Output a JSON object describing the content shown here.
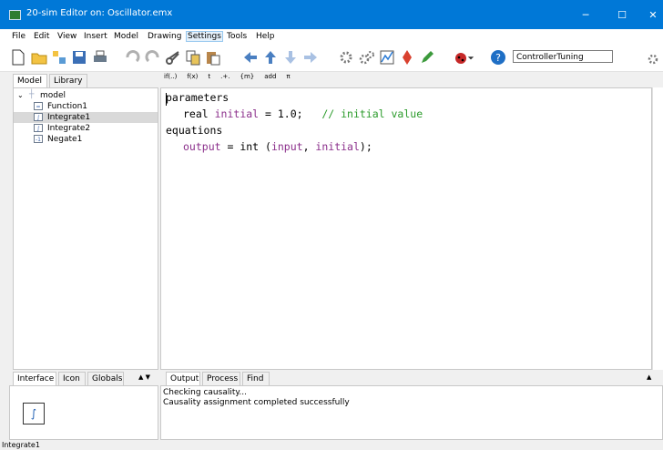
{
  "window": {
    "title": "20-sim Editor on: Oscillator.emx",
    "minimize": "─",
    "maximize": "☐",
    "close": "✕"
  },
  "menu": [
    "File",
    "Edit",
    "View",
    "Insert",
    "Model",
    "Drawing",
    "Settings",
    "Tools",
    "Help"
  ],
  "toolbar": {
    "combo_value": "ControllerTuning"
  },
  "symbols": [
    "if(..)",
    "f(x)",
    "t",
    ".+.",
    "{m}",
    "add",
    "π"
  ],
  "left_tabs": [
    "Model",
    "Library"
  ],
  "tree": {
    "root": "model",
    "items": [
      {
        "label": "Function1",
        "icon": "="
      },
      {
        "label": "Integrate1",
        "icon": "∫"
      },
      {
        "label": "Integrate2",
        "icon": "∫"
      },
      {
        "label": "Negate1",
        "icon": "-1"
      }
    ]
  },
  "code": {
    "l1": "parameters",
    "l2_type": "real ",
    "l2_ident": "initial",
    "l2_rest": " = 1.0;   ",
    "l2_comment": "// initial value",
    "l3": "equations",
    "l4_a": "output",
    "l4_b": " = int (",
    "l4_c": "input",
    "l4_d": ", ",
    "l4_e": "initial",
    "l4_f": ");"
  },
  "bottom_left_tabs": [
    "Interface",
    "Icon",
    "Globals"
  ],
  "bottom_right_tabs": [
    "Output",
    "Process",
    "Find"
  ],
  "output_lines": [
    "Checking causality...",
    "Causality assignment completed successfully"
  ],
  "status": "Integrate1",
  "colors": {
    "titlebar": "#0078d7",
    "identifier": "#8b2f8b",
    "comment": "#2b9b2b"
  }
}
